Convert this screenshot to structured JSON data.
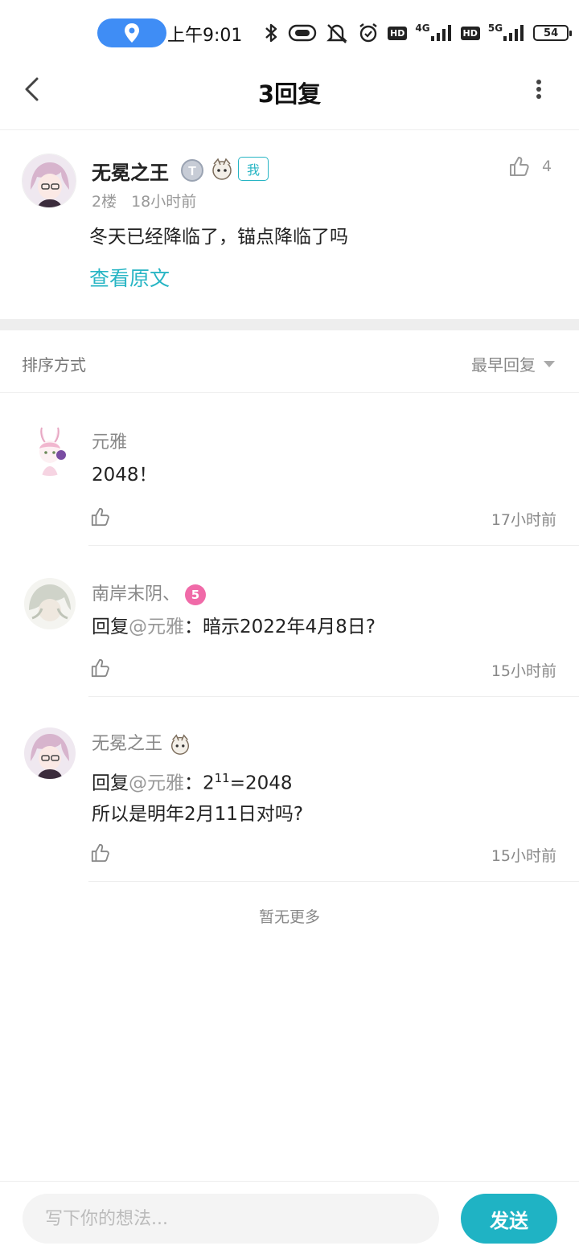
{
  "status_bar": {
    "time": "上午9:01",
    "network_4g": "4G",
    "network_5g": "5G",
    "hd_label": "HD",
    "battery": "54",
    "icons": [
      "location-icon",
      "bluetooth-icon",
      "nfc-icon",
      "mute-icon",
      "alarm-icon",
      "signal-icon"
    ]
  },
  "header": {
    "title": "3回复"
  },
  "post": {
    "author": "无冕之王",
    "me_tag": "我",
    "floor": "2楼",
    "time": "18小时前",
    "likes": "4",
    "text": "冬天已经降临了，锚点降临了吗",
    "view_original": "查看原文"
  },
  "sort": {
    "label": "排序方式",
    "selected": "最早回复"
  },
  "replies": [
    {
      "author": "元雅",
      "text": "2048！",
      "time": "17小时前"
    },
    {
      "author": "南岸末阴、",
      "level": "5",
      "reply_prefix": "回复",
      "mention": "@元雅",
      "text": "：暗示2022年4月8日?",
      "time": "15小时前"
    },
    {
      "author": "无冕之王",
      "reply_prefix": "回复",
      "mention": "@元雅",
      "text_base": "：2",
      "text_sup": "11",
      "text_rest": "=2048",
      "text_line2": "所以是明年2月11日对吗?",
      "time": "15小时前"
    }
  ],
  "footer_note": "暂无更多",
  "input": {
    "placeholder": "写下你的想法...",
    "send_label": "发送"
  },
  "colors": {
    "accent": "#1fb3c4",
    "location_pill": "#3f8df5",
    "level_badge": "#f06aa8"
  }
}
